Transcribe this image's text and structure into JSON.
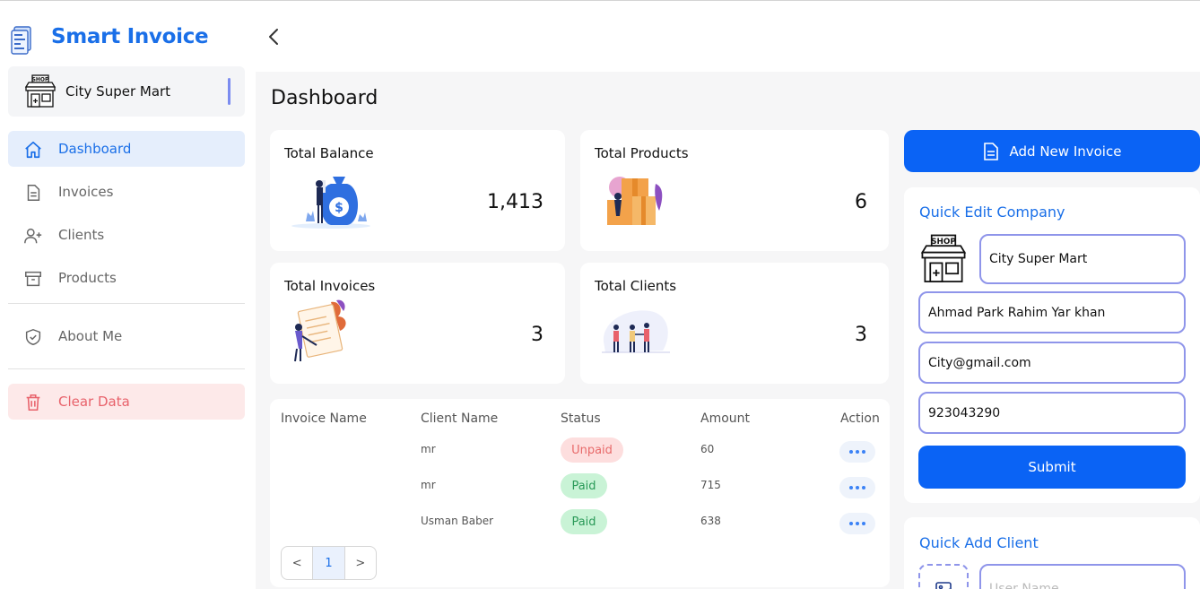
{
  "app": {
    "title": "Smart Invoice"
  },
  "company_selector": {
    "name": "City Super Mart",
    "logo_text": "SHOP"
  },
  "sidebar": {
    "items": [
      {
        "label": "Dashboard",
        "icon": "home-icon"
      },
      {
        "label": "Invoices",
        "icon": "document-icon"
      },
      {
        "label": "Clients",
        "icon": "user-add-icon"
      },
      {
        "label": "Products",
        "icon": "archive-box-icon"
      },
      {
        "label": "About Me",
        "icon": "shield-check-icon"
      },
      {
        "label": "Clear Data",
        "icon": "trash-icon"
      }
    ]
  },
  "header": {
    "back_icon": "chevron-left-icon"
  },
  "main": {
    "title": "Dashboard",
    "stats": [
      {
        "title": "Total Balance",
        "value": "1,413"
      },
      {
        "title": "Total Products",
        "value": "6"
      },
      {
        "title": "Total Invoices",
        "value": "3"
      },
      {
        "title": "Total Clients",
        "value": "3"
      }
    ],
    "table": {
      "columns": [
        "Invoice Name",
        "Client Name",
        "Status",
        "Amount",
        "Action"
      ],
      "rows": [
        {
          "invoice": "",
          "client": "mr",
          "status": "Unpaid",
          "amount": "60"
        },
        {
          "invoice": "",
          "client": "mr",
          "status": "Paid",
          "amount": "715"
        },
        {
          "invoice": "",
          "client": "Usman Baber",
          "status": "Paid",
          "amount": "638"
        }
      ]
    },
    "pagination": {
      "prev": "<",
      "current": "1",
      "next": ">"
    }
  },
  "right": {
    "add_invoice_label": "Add New Invoice",
    "quick_edit": {
      "title": "Quick Edit Company",
      "name": "City Super Mart",
      "address": "Ahmad Park Rahim Yar khan",
      "email": "City@gmail.com",
      "phone": "923043290",
      "submit_label": "Submit"
    },
    "quick_add_client": {
      "title": "Quick Add Client",
      "name_placeholder": "User Name"
    }
  },
  "colors": {
    "accent": "#1a6fe8",
    "primary_button": "#0a63f5",
    "danger": "#e8626b",
    "field_border": "#8f95ea"
  }
}
